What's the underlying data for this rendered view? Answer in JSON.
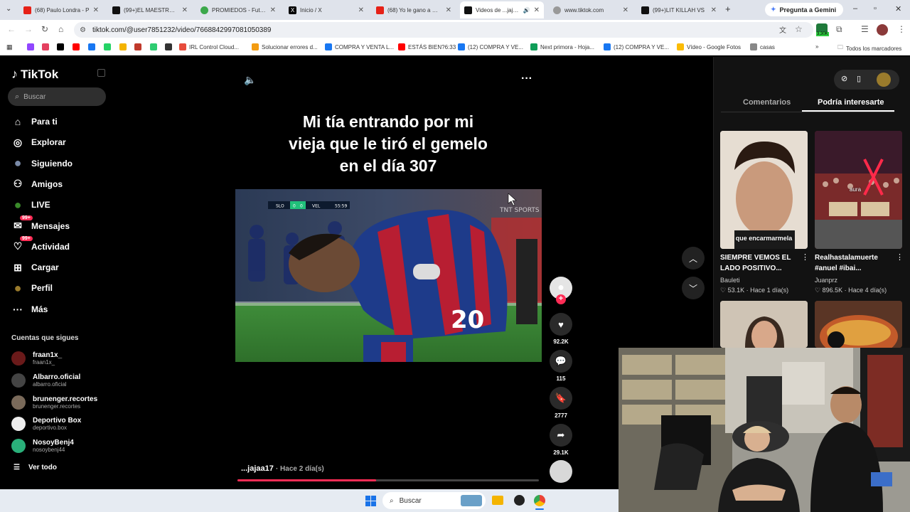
{
  "browser": {
    "tabs": [
      {
        "title": "(68) Paulo Londra - P",
        "icon": "youtube"
      },
      {
        "title": "(99+)EL MAESTRO DE",
        "icon": "tiktok"
      },
      {
        "title": "PROMIEDOS - Futbol",
        "icon": "promiedos"
      },
      {
        "title": "Inicio / X",
        "icon": "x"
      },
      {
        "title": "(68) Yo le gano a Gen",
        "icon": "youtube"
      },
      {
        "title": "Videos de ...jajaa1",
        "icon": "tiktok",
        "active": true
      },
      {
        "title": "www.tiktok.com",
        "icon": "globe"
      },
      {
        "title": "(99+)LIT KILLAH VS",
        "icon": "tiktok"
      }
    ],
    "gemini_label": "Pregunta a Gemini",
    "url": "tiktok.com/@user7851232/video/7668842997081050389",
    "extension_badge": "3,30K",
    "bookmarks": [
      {
        "label": "",
        "color": "#9146ff"
      },
      {
        "label": "",
        "color": "#e4405f"
      },
      {
        "label": "",
        "color": "#000000"
      },
      {
        "label": "",
        "color": "#ff0000"
      },
      {
        "label": "",
        "color": "#1877f2"
      },
      {
        "label": "",
        "color": "#25d366"
      },
      {
        "label": "",
        "color": "#f4b400"
      },
      {
        "label": "",
        "color": "#c0392b"
      },
      {
        "label": "",
        "color": "#2ecc71"
      },
      {
        "label": "",
        "color": "#333333"
      },
      {
        "label": "IRL Control Cloud...",
        "color": "#e74c3c"
      },
      {
        "label": "Solucionar errores d...",
        "color": "#f39c12"
      },
      {
        "label": "COMPRA Y VENTA L...",
        "color": "#1877f2"
      },
      {
        "label": "ESTÁS BIEN?6:33",
        "color": "#ff0000"
      },
      {
        "label": "(12) COMPRA Y VE...",
        "color": "#1877f2"
      },
      {
        "label": "Next primora - Hoja...",
        "color": "#0f9d58"
      },
      {
        "label": "(12) COMPRA Y VE...",
        "color": "#1877f2"
      },
      {
        "label": "Vídeo - Google Fotos",
        "color": "#fbbc05"
      },
      {
        "label": "casas",
        "color": "#888888"
      }
    ],
    "all_bookmarks_label": "Todos los marcadores"
  },
  "tiktok": {
    "logo": "TikTok",
    "search_placeholder": "Buscar",
    "nav": [
      {
        "label": "Para ti",
        "icon": "home-icon"
      },
      {
        "label": "Explorar",
        "icon": "compass-icon"
      },
      {
        "label": "Siguiendo",
        "icon": "following-icon"
      },
      {
        "label": "Amigos",
        "icon": "friends-icon"
      },
      {
        "label": "LIVE",
        "icon": "live-icon"
      },
      {
        "label": "Mensajes",
        "icon": "messages-icon",
        "badge": "99+"
      },
      {
        "label": "Actividad",
        "icon": "activity-icon",
        "badge": "99+"
      },
      {
        "label": "Cargar",
        "icon": "upload-icon"
      },
      {
        "label": "Perfil",
        "icon": "profile-icon"
      },
      {
        "label": "Más",
        "icon": "more-icon"
      }
    ],
    "following_title": "Cuentas que sigues",
    "following": [
      {
        "name": "fraan1x_",
        "handle": "fraan1x_"
      },
      {
        "name": "Albarro.oficial",
        "handle": "albarro.oficial"
      },
      {
        "name": "brunenger.recortes",
        "handle": "brunenger.recortes"
      },
      {
        "name": "Deportivo Box",
        "handle": "deportivo.box"
      },
      {
        "name": "NosoyBenj4",
        "handle": "nosoybenj44"
      }
    ],
    "see_all": "Ver todo",
    "video": {
      "caption_lines": [
        "Mi tía entrando por mi",
        "vieja que le tiró el gemelo",
        "en el día 307"
      ],
      "author": "...jajaa17",
      "time_ago": "· Hace 2 día(s)",
      "progress": 0.46,
      "scoreboard": {
        "home": "SLO",
        "home_score": "0",
        "away_score": "0",
        "away": "VEL",
        "time": "55:59"
      },
      "jersey_number": "20",
      "watermark": "TNT SPORTS"
    },
    "actions": {
      "likes": "92.2K",
      "comments": "115",
      "saves": "2777",
      "shares": "29.1K"
    },
    "right_tabs": {
      "comments": "Comentarios",
      "suggested": "Podría interesarte"
    },
    "suggestions": [
      {
        "overlay": "que encarmarmela",
        "title_lines": [
          "SIEMPRE VEMOS EL",
          "LADO POSITIVO..."
        ],
        "author": "Bauleti",
        "likes": "53.1K",
        "time": "Hace 1 día(s)"
      },
      {
        "overlay": "aura",
        "title_lines": [
          "Realhastalamuerte",
          "#anuel #ibai..."
        ],
        "author": "Juanprz",
        "likes": "896.5K",
        "time": "Hace 4 día(s)"
      }
    ]
  },
  "taskbar": {
    "search_placeholder": "Buscar"
  }
}
